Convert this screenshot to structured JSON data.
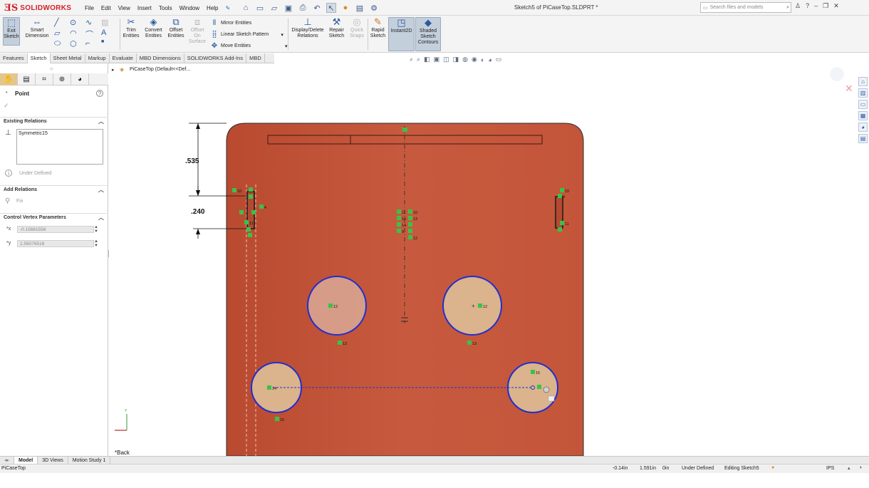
{
  "app": {
    "logo": "SOLIDWORKS",
    "doc_title": "Sketch5 of PiCaseTop.SLDPRT *"
  },
  "menus": [
    "File",
    "Edit",
    "View",
    "Insert",
    "Tools",
    "Window",
    "Help"
  ],
  "search": {
    "placeholder": "Search files and models"
  },
  "ribbon": {
    "exit_sketch": "Exit Sketch",
    "smart_dimension": "Smart Dimension",
    "trim_entities": "Trim Entities",
    "convert_entities": "Convert Entities",
    "offset_entities": "Offset Entities",
    "offset_on_surface": "Offset On Surface",
    "mirror_entities": "Mirror Entities",
    "linear_sketch_pattern": "Linear Sketch Pattern",
    "move_entities": "Move Entities",
    "display_delete_relations": "Display/Delete Relations",
    "repair_sketch": "Repair Sketch",
    "quick_snaps": "Quick Snaps",
    "rapid_sketch": "Rapid Sketch",
    "instant2d": "Instant2D",
    "shaded_sketch_contours": "Shaded Sketch Contours"
  },
  "tabs": [
    "Features",
    "Sketch",
    "Sheet Metal",
    "Markup",
    "Evaluate",
    "MBD Dimensions",
    "SOLIDWORKS Add-Ins",
    "MBD"
  ],
  "active_tab": "Sketch",
  "panel": {
    "title": "Point",
    "existing_relations_header": "Existing Relations",
    "relations": [
      "Symmetric15"
    ],
    "status": "Under Defined",
    "add_relations_header": "Add Relations",
    "fix_label": "Fix",
    "cvp_header": "Control Vertex Parameters",
    "x_value": "-0.15681556",
    "y_value": "1.56076516"
  },
  "tree": {
    "root": "PiCaseTop (Default<<Def..."
  },
  "drawing": {
    "dim_top": ".535",
    "dim_mid": ".240",
    "view_label": "*Back",
    "part_color": "#c4553a",
    "circle_fill": "#dbb38c",
    "sketch_blue": "#1f2fd0",
    "relation_green": "#39c24a",
    "tags": [
      "10",
      "11",
      "11",
      "9",
      "10",
      "12",
      "16",
      "14",
      "9",
      "12",
      "13",
      "13",
      "14",
      "15",
      "15",
      "12",
      "12"
    ]
  },
  "bottom_tabs": [
    "Model",
    "3D Views",
    "Motion Study 1"
  ],
  "status": {
    "part": "PiCaseTop",
    "x": "-0.14in",
    "y": "1.591in",
    "z": "0in",
    "state": "Under Defined",
    "editing": "Editing Sketch5",
    "units": "IPS"
  }
}
